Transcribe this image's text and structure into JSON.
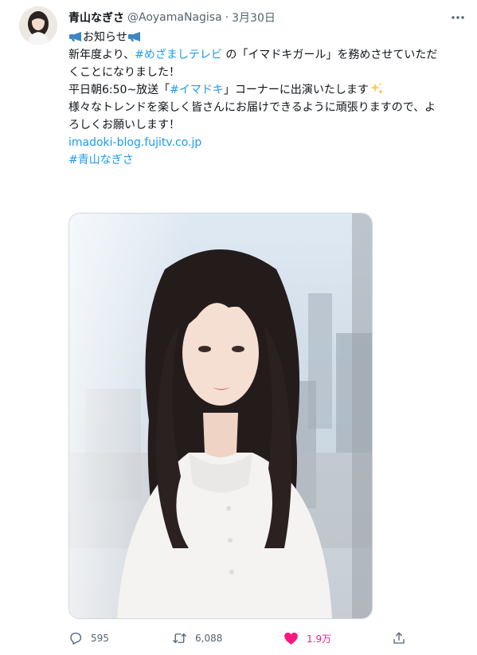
{
  "tweet": {
    "display_name": "青山なぎさ",
    "handle": "@AoyamaNagisa",
    "separator": "·",
    "date": "3月30日",
    "body": {
      "notice": "お知らせ",
      "p1_a": "新年度より、",
      "p1_hashtag": "#めざましテレビ",
      "p1_b": " の「イマドキガール」を務めさせていただ",
      "p1_c": "くことになりました！",
      "p2_a": "平日朝6:50~放送「",
      "p2_hashtag": "#イマドキ",
      "p2_b": "」コーナーに出演いたします",
      "p3_a": "様々なトレンドを楽しく皆さんにお届けできるように頑張りますので、よ",
      "p3_b": "ろしくお願いします！",
      "link": "imadoki-blog.fujitv.co.jp",
      "hashtag_name": "#青山なぎさ"
    },
    "actions": {
      "replies": "595",
      "retweets": "6,088",
      "likes": "1.9万"
    }
  },
  "icons": {
    "more": "more-icon",
    "megaphone": "megaphone-icon",
    "sparkles": "sparkles-icon",
    "reply": "reply-icon",
    "retweet": "retweet-icon",
    "like": "heart-icon",
    "share": "share-icon"
  },
  "colors": {
    "link": "#1d9bf0",
    "like": "#f91880",
    "secondary": "#536471"
  }
}
